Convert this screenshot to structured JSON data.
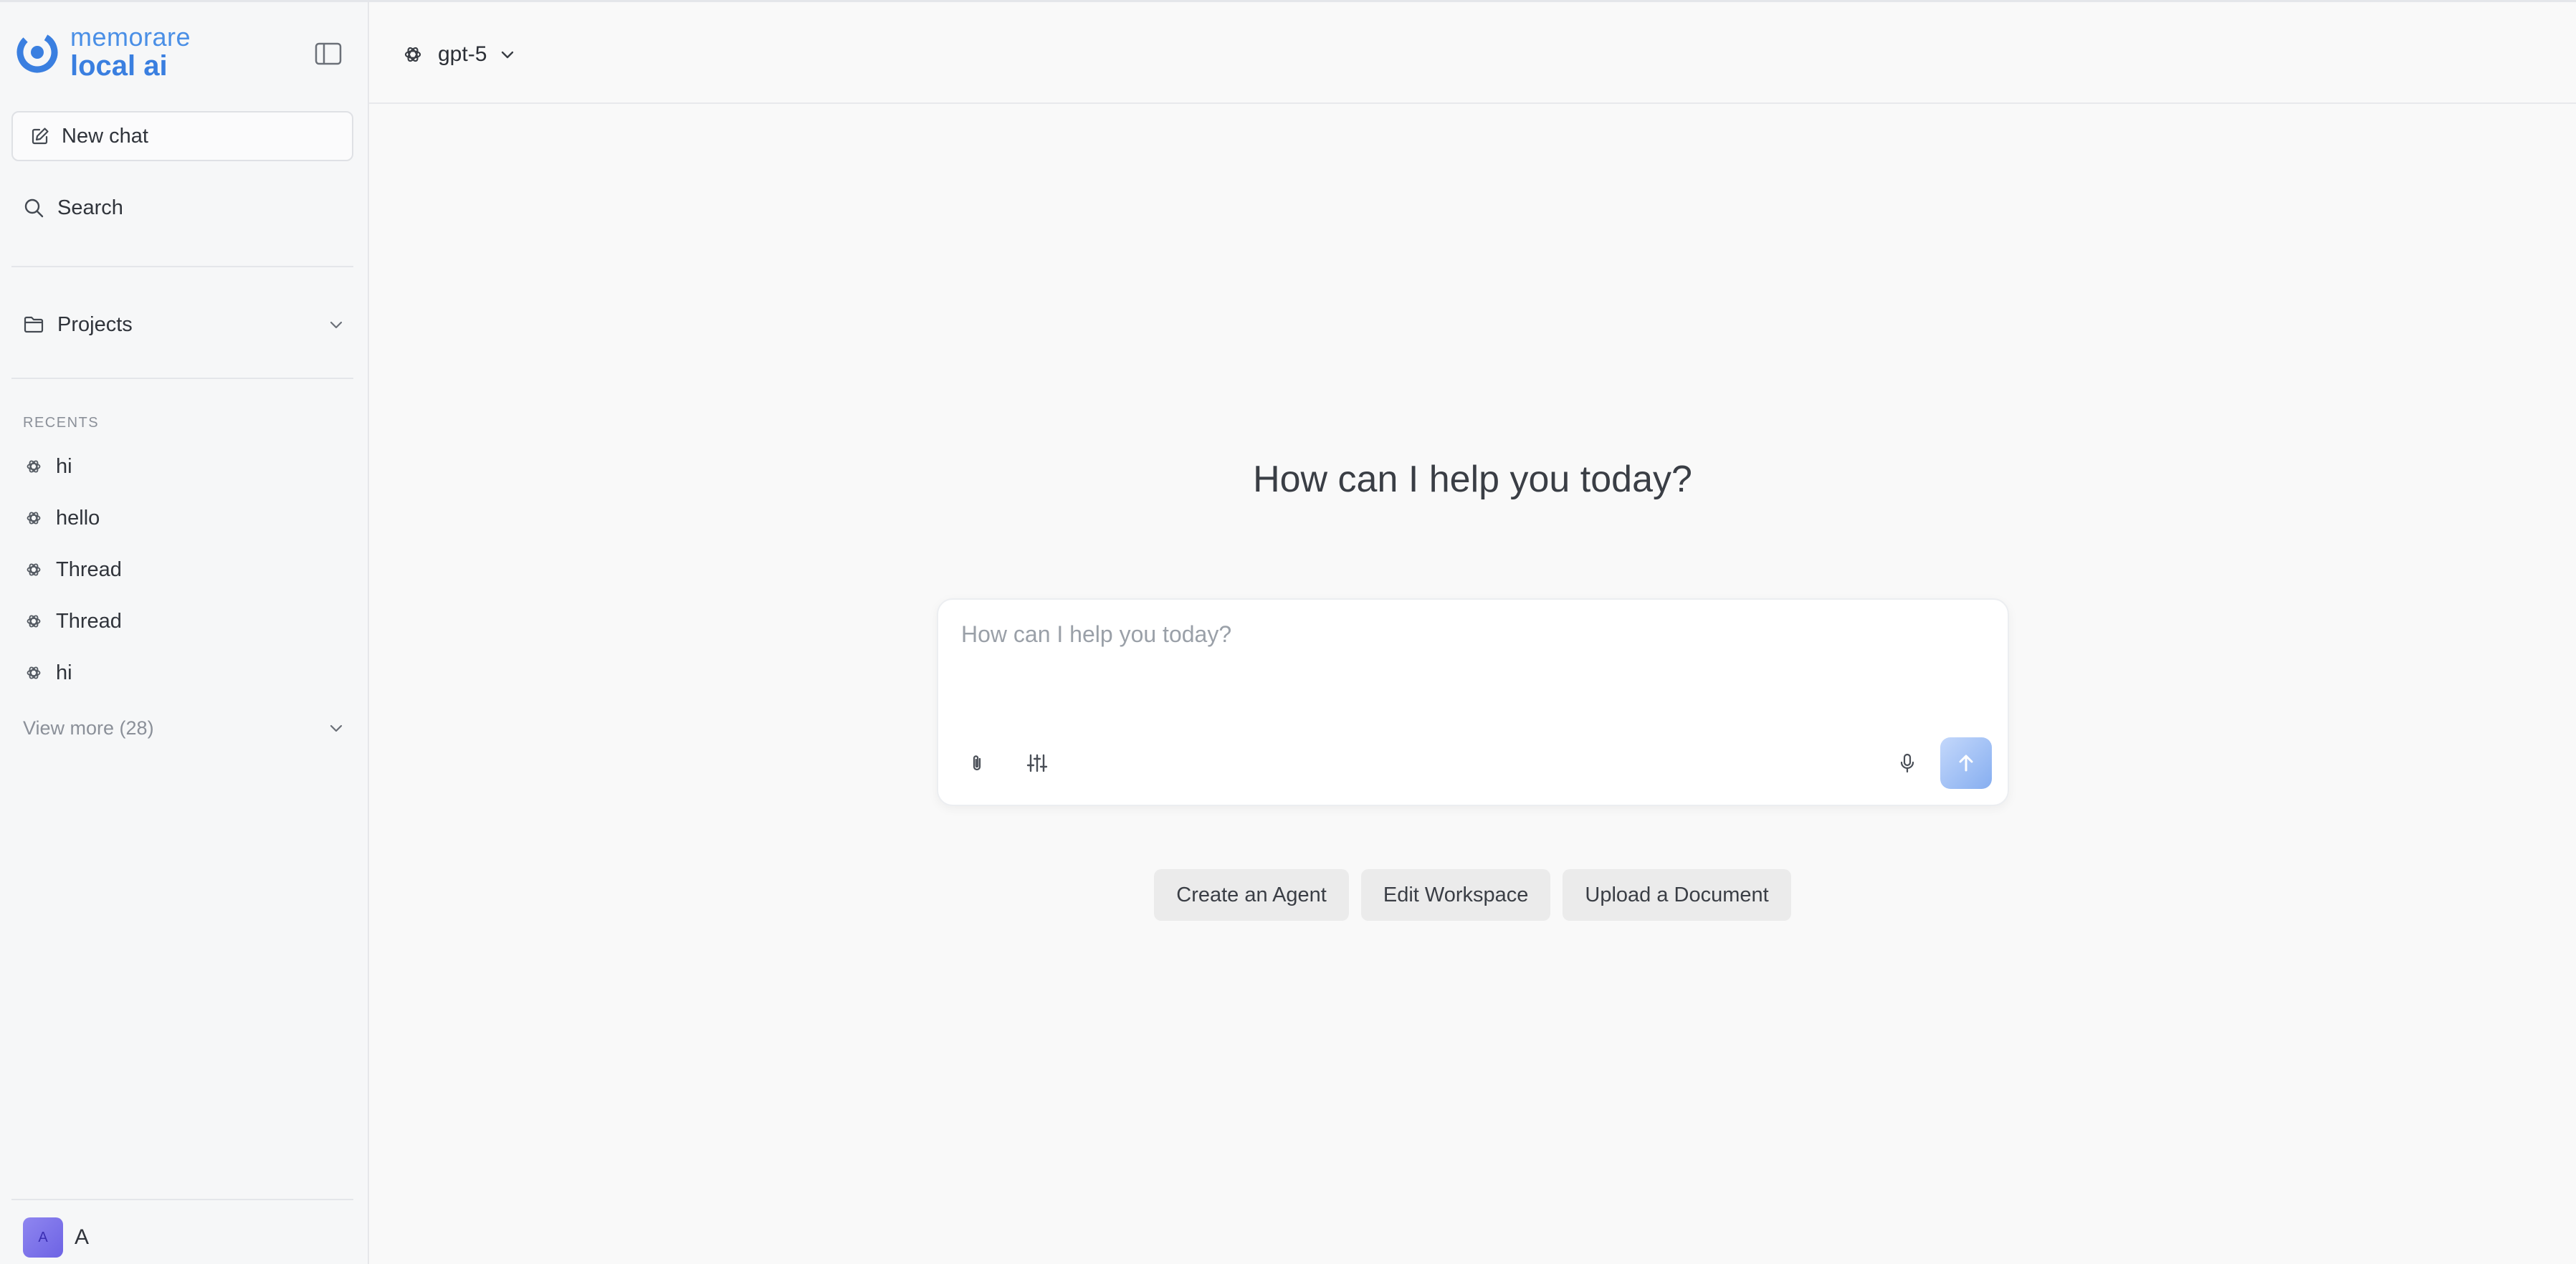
{
  "brand": {
    "line1": "memorare",
    "line2": "local ai"
  },
  "sidebar": {
    "new_chat_label": "New chat",
    "search_label": "Search",
    "projects_label": "Projects",
    "recents_title": "RECENTS",
    "recents": [
      {
        "label": "hi"
      },
      {
        "label": "hello"
      },
      {
        "label": "Thread"
      },
      {
        "label": "Thread"
      },
      {
        "label": "hi"
      }
    ],
    "view_more_label": "View more (28)",
    "user": {
      "avatar_initial": "A",
      "name": "A"
    }
  },
  "header": {
    "model_name": "gpt-5"
  },
  "main": {
    "headline": "How can I help you today?",
    "composer": {
      "placeholder": "How can I help you today?",
      "value": ""
    },
    "suggestions": [
      {
        "label": "Create an Agent"
      },
      {
        "label": "Edit Workspace"
      },
      {
        "label": "Upload a Document"
      }
    ]
  },
  "icons": {
    "logo": "memorare-logo-icon",
    "collapse": "sidebar-toggle-icon",
    "new_chat": "edit-icon",
    "search": "search-icon",
    "projects": "folder-icon",
    "chevron": "chevron-down-icon",
    "model": "openai-icon",
    "attach": "paperclip-icon",
    "settings": "sliders-icon",
    "mic": "microphone-icon",
    "send": "arrow-up-icon"
  },
  "colors": {
    "accent": "#3a7fe0",
    "send_button": "#86aef0",
    "avatar": "#6d63e4",
    "sidebar_bg": "#f6f7f8",
    "main_bg": "#f9f9f9"
  }
}
